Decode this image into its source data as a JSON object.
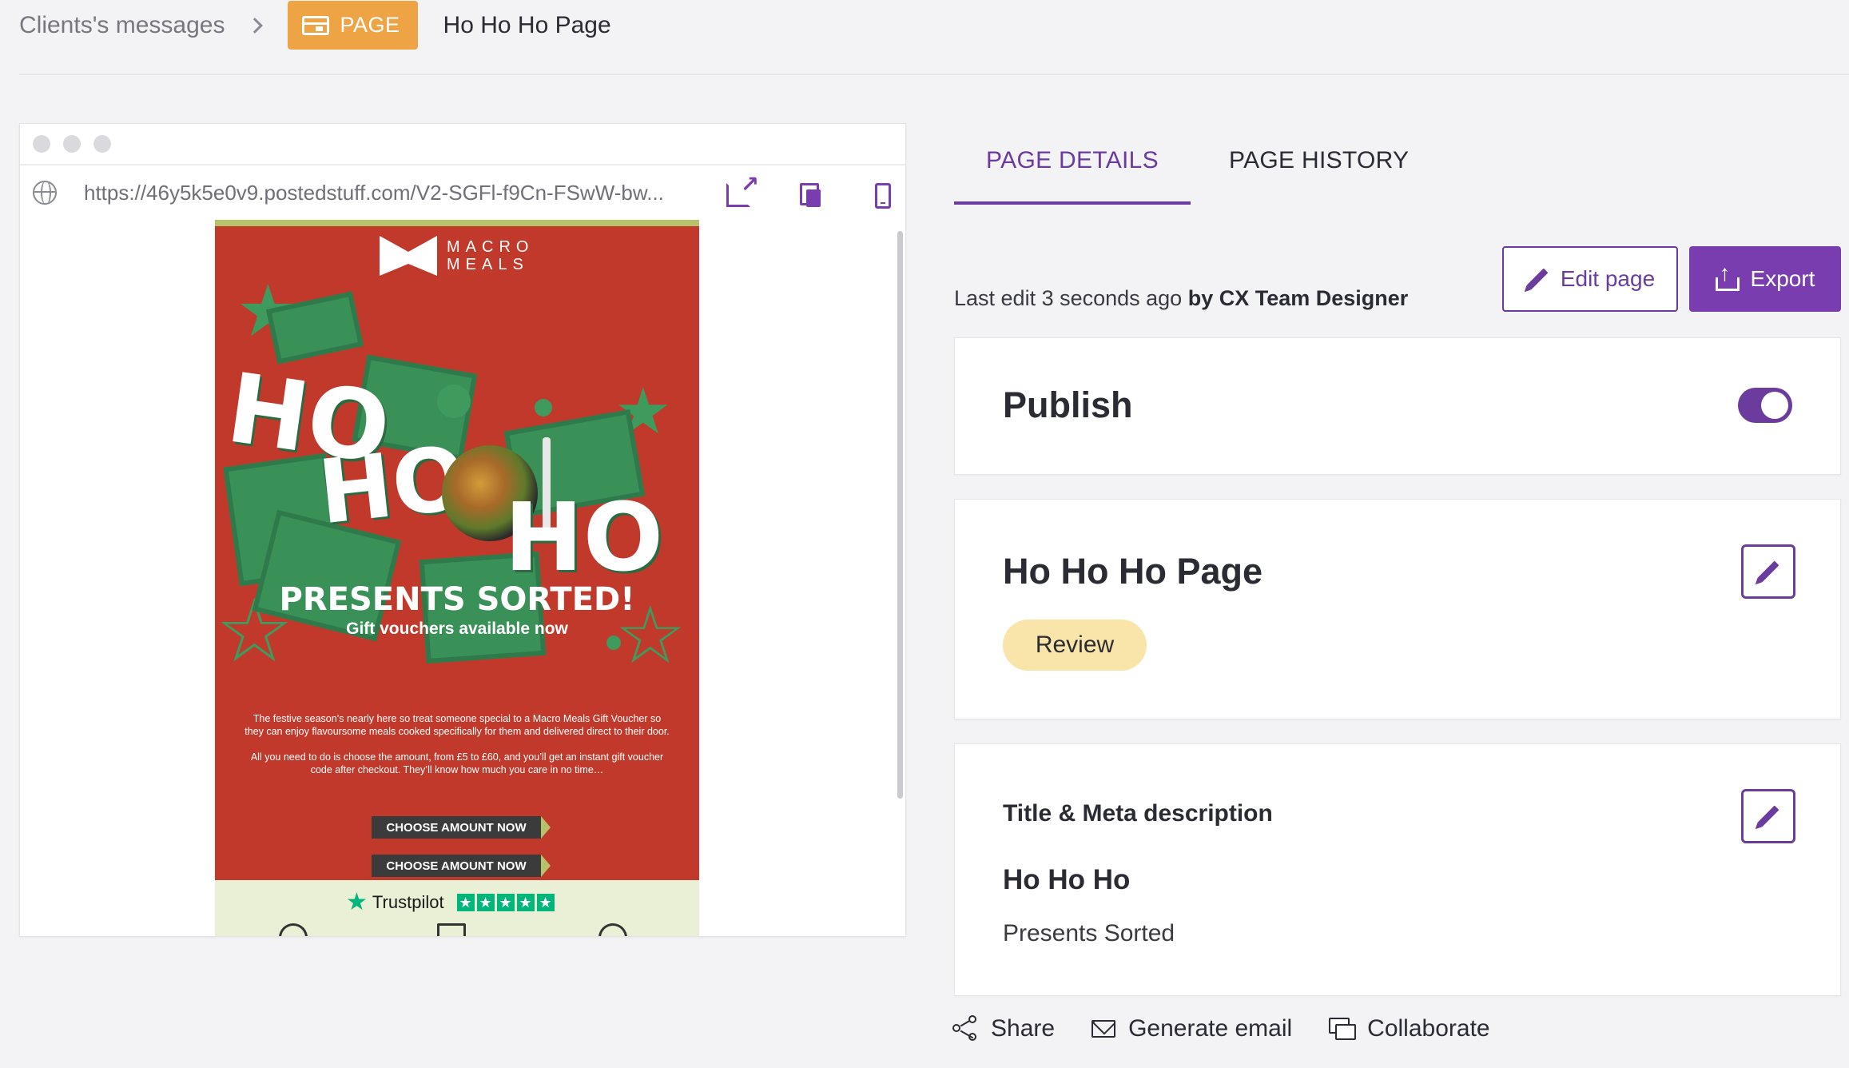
{
  "breadcrumb": {
    "parent": "Clients's messages",
    "type_badge": "PAGE",
    "current": "Ho Ho Ho Page"
  },
  "preview": {
    "url": "https://46y5k5e0v9.postedstuff.com/V2-SGFl-f9Cn-FSwW-bw...",
    "email": {
      "brand_line1": "MACRO",
      "brand_line2": "MEALS",
      "hero_word1": "HO",
      "hero_word2": "HO",
      "hero_word3": "HO",
      "headline": "PRESENTS SORTED!",
      "subheadline": "Gift vouchers available now",
      "body_p1": "The festive season’s nearly here so treat someone special to a Macro Meals Gift Voucher so they can enjoy flavoursome meals cooked specifically for them and delivered direct to their door.",
      "body_p2": "All you need to do is choose the amount, from £5 to £60, and you’ll get an instant gift voucher code after checkout. They’ll know how much you care in no time…",
      "cta1": "CHOOSE AMOUNT NOW",
      "cta2": "CHOOSE AMOUNT NOW",
      "trustpilot": "Trustpilot",
      "rating_stars": 5
    }
  },
  "tabs": [
    {
      "label": "PAGE DETAILS",
      "active": true
    },
    {
      "label": "PAGE HISTORY",
      "active": false
    }
  ],
  "last_edit": {
    "text": "Last edit 3 seconds ago",
    "by": "by CX Team Designer"
  },
  "buttons": {
    "edit_page": "Edit page",
    "export": "Export"
  },
  "publish": {
    "label": "Publish",
    "enabled": true
  },
  "page_card": {
    "title": "Ho Ho Ho Page",
    "status": "Review"
  },
  "meta_card": {
    "heading": "Title & Meta description",
    "meta_title": "Ho Ho Ho",
    "meta_description": "Presents Sorted"
  },
  "actions": {
    "share": "Share",
    "generate_email": "Generate email",
    "collaborate": "Collaborate"
  },
  "colors": {
    "accent": "#6b3b9e",
    "page_badge": "#eea445",
    "review_badge": "#f9e4a9",
    "email_bg": "#c0392b"
  },
  "icons": [
    "globe-icon",
    "external-link-icon",
    "copy-icon",
    "mobile-icon",
    "pencil-icon",
    "upload-icon",
    "share-icon",
    "mail-icon",
    "collaborate-icon"
  ]
}
